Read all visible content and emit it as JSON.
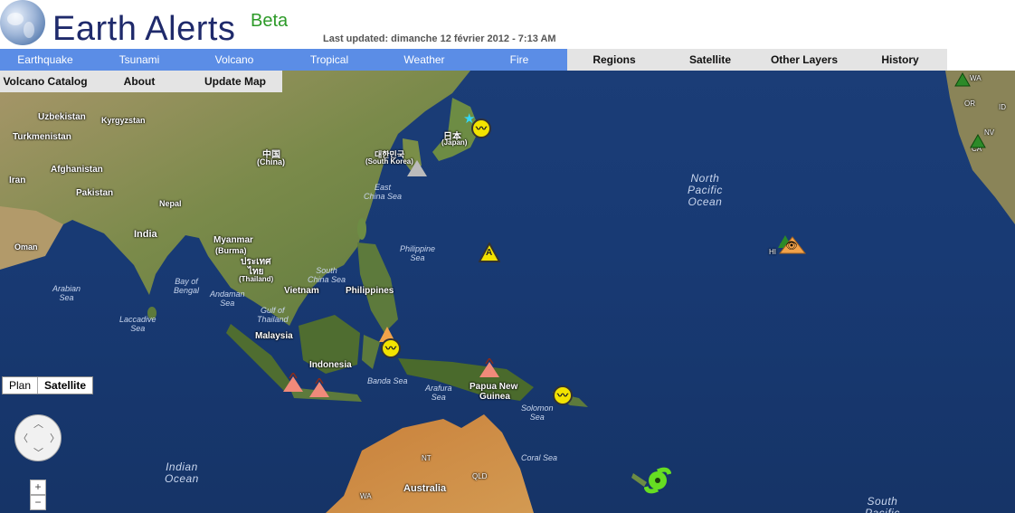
{
  "header": {
    "title": "Earth Alerts",
    "beta": "Beta",
    "last_updated": "Last updated: dimanche 12 février 2012 - 7:13 AM"
  },
  "nav": {
    "primary": [
      "Earthquake",
      "Tsunami",
      "Volcano",
      "Tropical",
      "Weather",
      "Fire"
    ],
    "secondary": [
      "Regions",
      "Satellite",
      "Other Layers",
      "History"
    ],
    "sub": [
      "Volcano Catalog",
      "About",
      "Update Map"
    ]
  },
  "map": {
    "type_control": {
      "plan": "Plan",
      "satellite": "Satellite"
    },
    "zoom": {
      "in": "+",
      "out": "−"
    },
    "country_labels": [
      "Uzbekistan",
      "Kyrgyzstan",
      "Turkmenistan",
      "Afghanistan",
      "Iran",
      "Pakistan",
      "Nepal",
      "India",
      "Oman",
      "中国",
      "(China)",
      "日本",
      "(Japan)",
      "대한민국",
      "(South Korea)",
      "Myanmar",
      "(Burma)",
      "ประเทศ",
      "ไทย",
      "(Thailand)",
      "Vietnam",
      "Philippines",
      "Malaysia",
      "Indonesia",
      "Papua New",
      "Guinea",
      "Australia",
      "NT",
      "QLD",
      "WA",
      "HI",
      "WA",
      "OR",
      "ID",
      "NV",
      "CA"
    ],
    "sea_labels": [
      "East\nChina Sea",
      "Philippine\nSea",
      "South\nChina Sea",
      "Bay of\nBengal",
      "Andaman\nSea",
      "Arabian\nSea",
      "Laccadive\nSea",
      "Gulf of\nThailand",
      "Banda Sea",
      "Arafura\nSea",
      "Solomon\nSea",
      "Coral Sea"
    ],
    "ocean_labels": [
      "North\nPacific\nOcean",
      "Indian\nOcean",
      "South\nPacific"
    ],
    "marker_labels": {
      "earthquake": "〰",
      "tsunami": "A",
      "watch": "👁"
    }
  },
  "colors": {
    "ocean": "#183a74",
    "nav_blue": "#5b8de6",
    "nav_gray": "#e4e4e4",
    "title": "#1f2a6b",
    "beta": "#2c9a28",
    "earthquake": "#f3e300",
    "volcano": "#f08a7a",
    "storm": "#66dd22"
  }
}
